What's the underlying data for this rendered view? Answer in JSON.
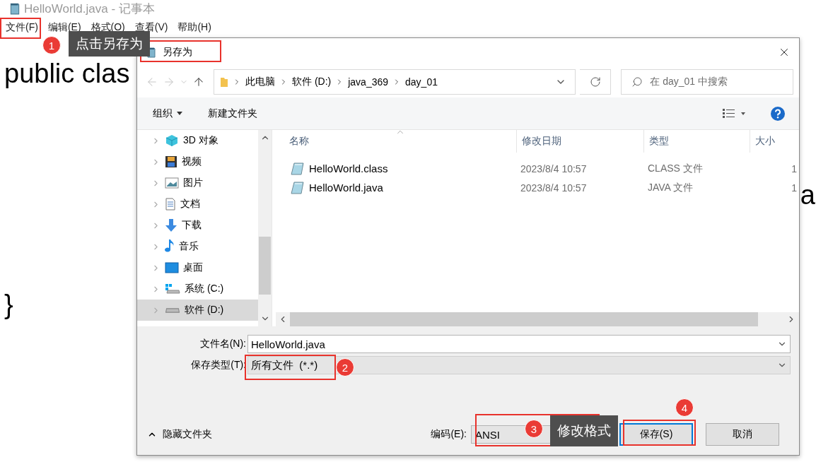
{
  "window": {
    "title": "HelloWorld.java - 记事本"
  },
  "menu": [
    {
      "label": "文件(F)"
    },
    {
      "label": "编辑(E)"
    },
    {
      "label": "格式(O)"
    },
    {
      "label": "查看(V)"
    },
    {
      "label": "帮助(H)"
    }
  ],
  "editor": {
    "lines": [
      {
        "text": "public clas"
      },
      {
        "text": "a"
      },
      {
        "text": "}"
      }
    ]
  },
  "dialog": {
    "title": "另存为",
    "breadcrumb": [
      "此电脑",
      "软件 (D:)",
      "java_369",
      "day_01"
    ],
    "search": {
      "placeholder": "在 day_01 中搜索"
    },
    "toolbar": {
      "organize": "组织",
      "new_folder": "新建文件夹"
    },
    "nav_items": [
      {
        "label": "3D 对象",
        "kind": "objects",
        "selected": false
      },
      {
        "label": "视频",
        "kind": "video",
        "selected": false
      },
      {
        "label": "图片",
        "kind": "pictures",
        "selected": false
      },
      {
        "label": "文档",
        "kind": "documents",
        "selected": false
      },
      {
        "label": "下载",
        "kind": "downloads",
        "selected": false
      },
      {
        "label": "音乐",
        "kind": "music",
        "selected": false
      },
      {
        "label": "桌面",
        "kind": "desktop",
        "selected": false
      },
      {
        "label": "系统 (C:)",
        "kind": "system_drive",
        "selected": false
      },
      {
        "label": "软件 (D:)",
        "kind": "drive",
        "selected": true
      }
    ],
    "columns": [
      "名称",
      "修改日期",
      "类型",
      "大小"
    ],
    "files": [
      {
        "name": "HelloWorld.class",
        "modified": "2023/8/4 10:57",
        "type": "CLASS 文件",
        "size": "1"
      },
      {
        "name": "HelloWorld.java",
        "modified": "2023/8/4 10:57",
        "type": "JAVA 文件",
        "size": "1"
      }
    ],
    "filename": {
      "label": "文件名(N):",
      "value": "HelloWorld.java"
    },
    "save_type": {
      "label": "保存类型(T):",
      "value": "所有文件  (*.*)"
    },
    "hide_folders": "隐藏文件夹",
    "encoding": {
      "label": "编码(E):",
      "value": "ANSI"
    },
    "buttons": [
      {
        "label": "保存(S)",
        "kind": "primary"
      },
      {
        "label": "取消",
        "kind": "normal"
      }
    ]
  },
  "annotations": [
    {
      "number": "1",
      "note": "点击另存为"
    },
    {
      "number": "2"
    },
    {
      "number": "3",
      "note": "修改格式"
    },
    {
      "number": "4"
    }
  ]
}
